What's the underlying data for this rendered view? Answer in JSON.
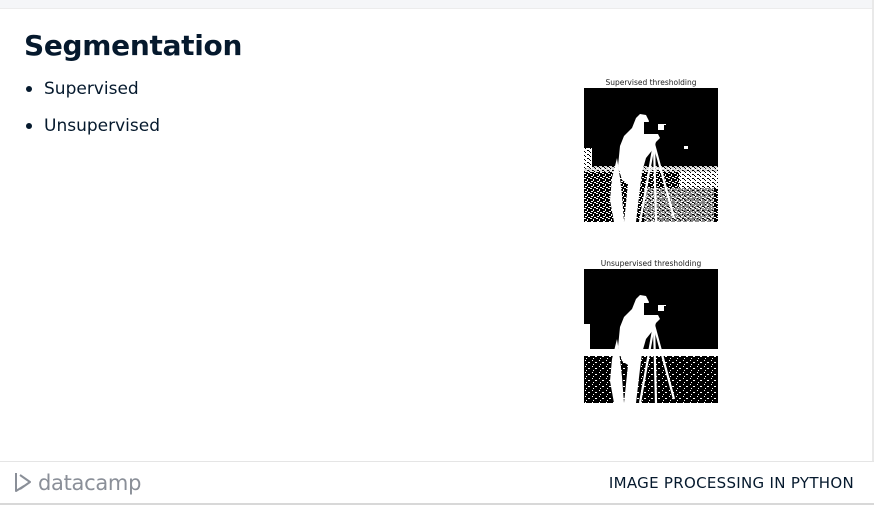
{
  "slide": {
    "title": "Segmentation",
    "bullets": [
      {
        "label": "Supervised"
      },
      {
        "label": "Unsupervised"
      }
    ]
  },
  "figures": [
    {
      "caption": "Supervised thresholding"
    },
    {
      "caption": "Unsupervised thresholding"
    }
  ],
  "footer": {
    "logo_text": "datacamp",
    "course_title": "IMAGE PROCESSING IN PYTHON"
  },
  "colors": {
    "text_dark": "#05192d",
    "logo_gray": "#8a8f98"
  }
}
